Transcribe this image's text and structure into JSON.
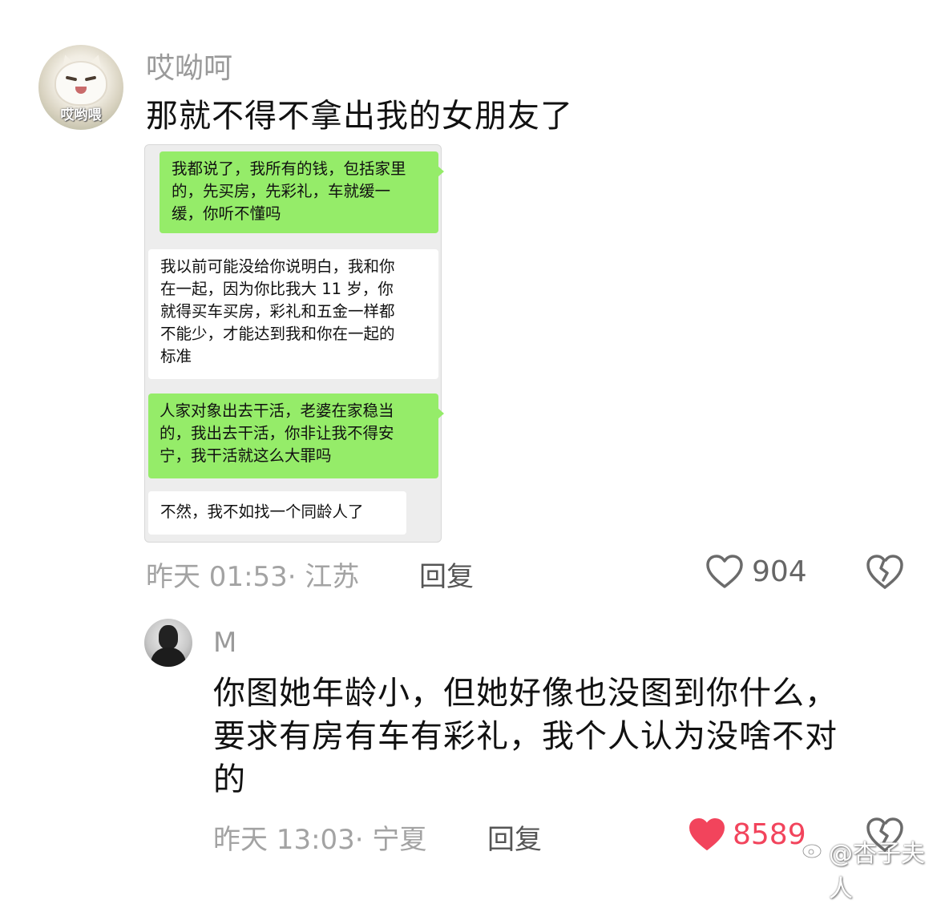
{
  "comment1": {
    "avatar_badge": "哎哟喂",
    "username": "哎呦呵",
    "text": "那就不得不拿出我的女朋友了",
    "chat": [
      {
        "side": "right",
        "color": "green",
        "lines": [
          "我都说了，我所有的钱，包括家里",
          "的，先买房，先彩礼，车就缓一",
          "缓，你听不懂吗"
        ]
      },
      {
        "side": "left",
        "color": "white",
        "lines": [
          "我以前可能没给你说明白，我和你",
          "在一起，因为你比我大 11 岁，你",
          "就得买车买房，彩礼和五金一样都",
          "不能少，才能达到我和你在一起的",
          "标准"
        ]
      },
      {
        "side": "right",
        "color": "green",
        "lines": [
          "人家对象出去干活，老婆在家稳当",
          "的，我出去干活，你非让我不得安",
          "宁，我干活就这么大罪吗"
        ]
      },
      {
        "side": "left",
        "color": "white",
        "lines": [
          "不然，我不如找一个同龄人了"
        ]
      }
    ],
    "time_location": "昨天 01:53· 江苏",
    "reply_label": "回复",
    "likes": "904",
    "liked": false,
    "like_icon": "heart-outline-icon",
    "dislike_icon": "broken-heart-icon"
  },
  "comment2": {
    "username": "M",
    "text_lines": [
      "你图她年龄小，但她好像也没图到你什么，",
      "要求有房有车有彩礼，我个人认为没啥不对",
      "的"
    ],
    "time_location": "昨天 13:03· 宁夏",
    "reply_label": "回复",
    "likes": "8589",
    "liked": true,
    "like_icon": "heart-filled-icon",
    "dislike_icon": "broken-heart-icon"
  },
  "watermark": "@杏子夫人",
  "colors": {
    "liked_red": "#f2445c",
    "wechat_green": "#95ec69",
    "meta_gray": "#a3a3a3"
  }
}
